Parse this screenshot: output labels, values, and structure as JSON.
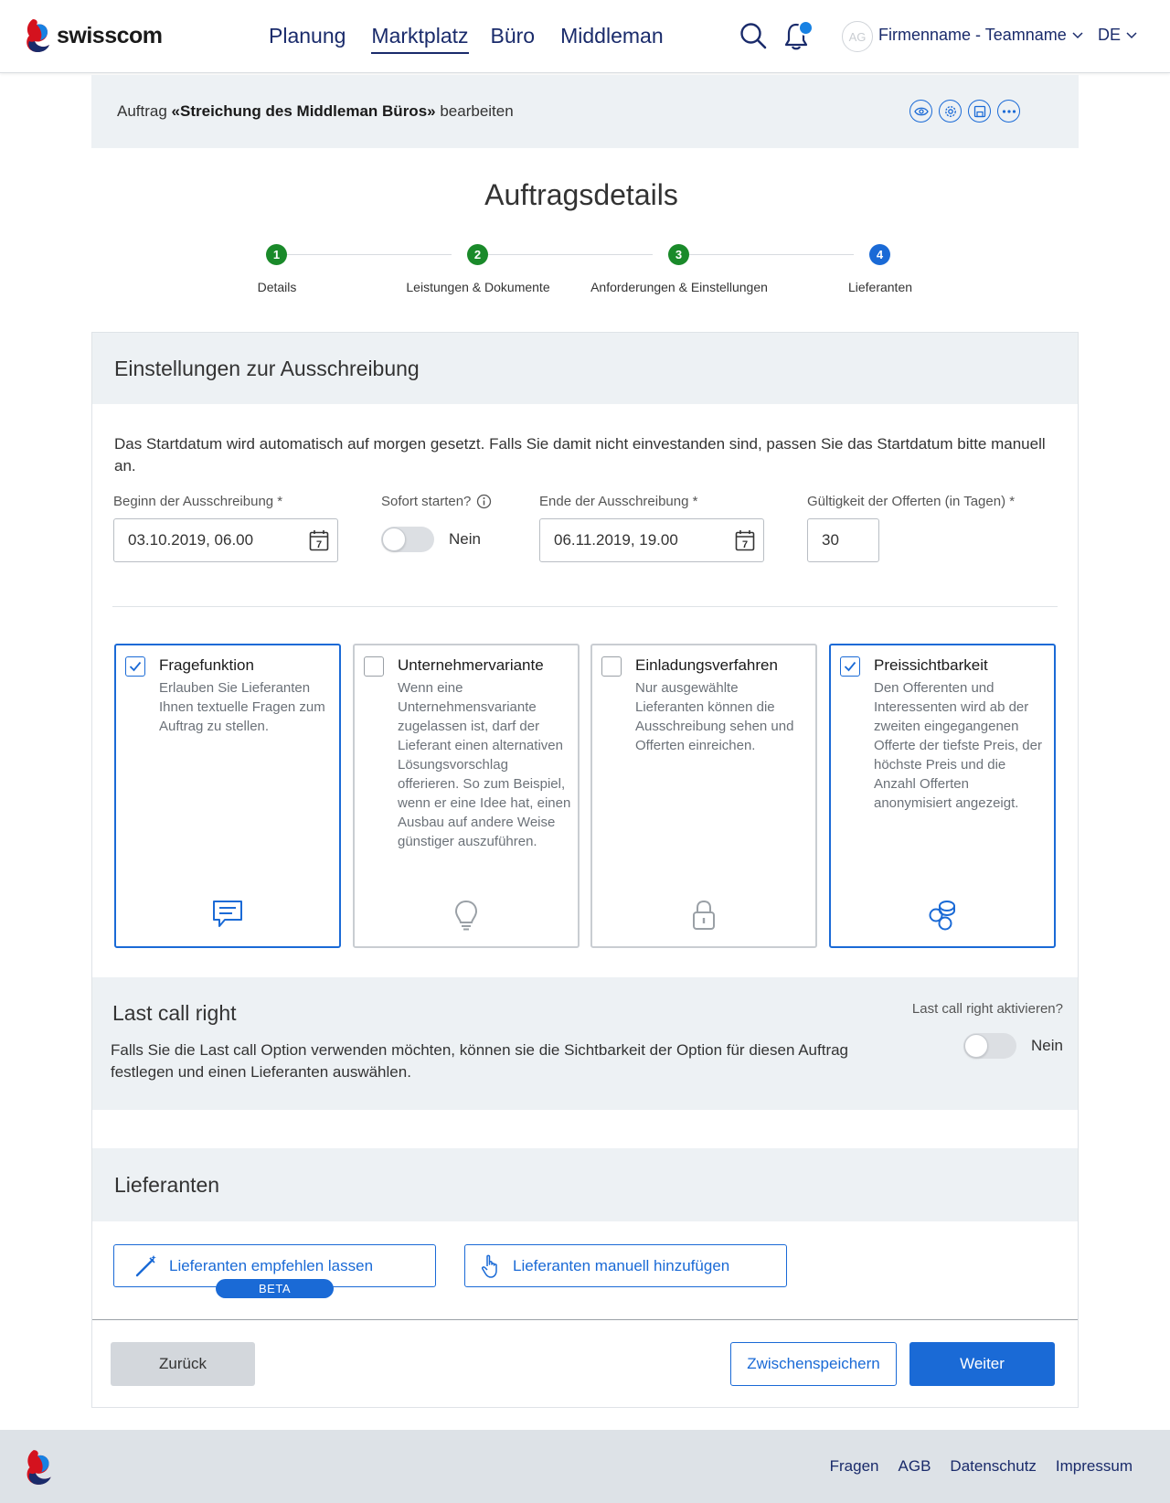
{
  "header": {
    "logo_text": "swisscom",
    "nav": [
      "Planung",
      "Marktplatz",
      "Büro",
      "Middleman"
    ],
    "active_nav": "Marktplatz",
    "avatar_initials": "AG",
    "company": "Firmenname - Teamname",
    "language": "DE"
  },
  "subheader": {
    "prefix": "Auftrag",
    "order_name": "«Streichung des Middleman Büros»",
    "suffix": "bearbeiten",
    "icons": [
      "eye-icon",
      "gear-icon",
      "save-icon",
      "more-icon"
    ]
  },
  "page": {
    "title": "Auftragsdetails"
  },
  "stepper": {
    "steps": [
      {
        "number": "1",
        "label": "Details",
        "state": "done"
      },
      {
        "number": "2",
        "label": "Leistungen & Dokumente",
        "state": "done"
      },
      {
        "number": "3",
        "label": "Anforderungen & Einstellungen",
        "state": "done"
      },
      {
        "number": "4",
        "label": "Lieferanten",
        "state": "current"
      }
    ]
  },
  "settings": {
    "heading": "Einstellungen zur Ausschreibung",
    "intro": "Das Startdatum wird automatisch auf morgen gesetzt. Falls Sie damit nicht einvestanden sind, passen Sie das Startdatum bitte manuell an.",
    "start_label": "Beginn der Ausschreibung *",
    "start_value": "03.10.2019, 06.00",
    "immediate_label": "Sofort starten?",
    "immediate_value": "Nein",
    "end_label": "Ende der Ausschreibung *",
    "end_value": "06.11.2019, 19.00",
    "validity_label": "Gültigkeit der Offerten (in Tagen) *",
    "validity_value": "30",
    "calendar_day": "7"
  },
  "options": [
    {
      "title": "Fragefunktion",
      "description": "Erlauben Sie Lieferanten Ihnen textuelle Fragen zum Auftrag zu stellen.",
      "checked": true,
      "icon": "chat-icon"
    },
    {
      "title": "Unternehmervariante",
      "description": "Wenn eine Unternehmensvariante zugelassen ist, darf der Lieferant einen alternativen Lösungsvorschlag offerieren. So zum Beispiel, wenn er eine Idee hat, einen Ausbau auf andere Weise günstiger auszuführen.",
      "checked": false,
      "icon": "lightbulb-icon"
    },
    {
      "title": "Einladungsverfahren",
      "description": "Nur ausgewählte Lieferanten können die Ausschreibung sehen und Offerten einreichen.",
      "checked": false,
      "icon": "lock-icon"
    },
    {
      "title": "Preissichtbarkeit",
      "description": "Den Offerenten und Interessenten wird ab der zweiten eingegangenen Offerte der tiefste Preis, der höchste Preis und die Anzahl Offerten anonymisiert angezeigt.",
      "checked": true,
      "icon": "coins-icon"
    }
  ],
  "last_call": {
    "heading": "Last call right",
    "description": "Falls Sie die Last call Option verwenden möchten, können sie die Sichtbarkeit der Option für diesen Auftrag festlegen und einen Lieferanten auswählen.",
    "question": "Last call right aktivieren?",
    "value": "Nein"
  },
  "suppliers": {
    "heading": "Lieferanten",
    "recommend_label": "Lieferanten empfehlen lassen",
    "beta_label": "BETA",
    "manual_label": "Lieferanten manuell hinzufügen"
  },
  "actions": {
    "back": "Zurück",
    "save": "Zwischenspeichern",
    "next": "Weiter"
  },
  "footer": {
    "links": [
      "Fragen",
      "AGB",
      "Datenschutz",
      "Impressum"
    ]
  },
  "colors": {
    "brand_blue": "#1a6ad6",
    "nav_blue": "#1a2b6b",
    "done_green": "#1a8a2a",
    "panel_bg": "#edf1f4"
  }
}
